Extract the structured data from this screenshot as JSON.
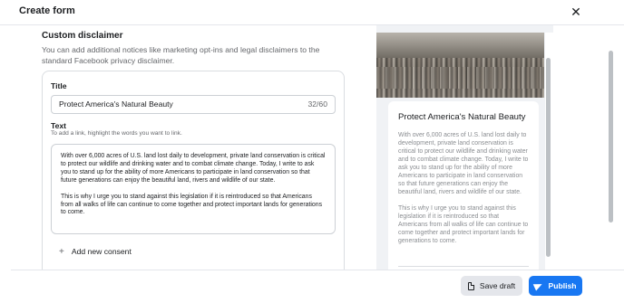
{
  "header": {
    "title": "Create form",
    "close_icon": "close-icon"
  },
  "section": {
    "title": "Custom disclaimer",
    "description": "You can add additional notices like marketing opt-ins and legal disclaimers to the standard Facebook privacy disclaimer."
  },
  "form": {
    "title_label": "Title",
    "title_value": "Protect America's Natural Beauty",
    "title_count": "32/60",
    "text_label": "Text",
    "text_hint": "To add a link, highlight the words you want to link.",
    "text_paragraph_1": "With over 6,000 acres of U.S. land lost daily to development, private land conservation is critical to protect our wildlife and drinking water and to combat climate change. Today, I write to ask you to stand up for the ability of more Americans to participate in land conservation so that future generations can enjoy the beautiful land, rivers and wildlife of our state.",
    "text_paragraph_2": "This is why I urge you to stand against this legislation if it is reintroduced so that Americans from all walks of life can continue to come together and protect important lands for generations to come.",
    "add_consent_label": "Add new consent"
  },
  "preview": {
    "title": "Protect America's Natural Beauty",
    "paragraph_1": "With over 6,000 acres of U.S. land lost daily to development, private land conservation is critical to protect our wildlife and drinking water and to combat climate change. Today, I write to ask you to stand up for the ability of more Americans to participate in land conservation so that future generations can enjoy the beautiful land, rivers and wildlife of our state.",
    "paragraph_2": "This is why I urge you to stand against this legislation if it is reintroduced so that Americans from all walks of life can continue to come together and protect important lands for generations to come."
  },
  "footer": {
    "save_draft_label": "Save draft",
    "publish_label": "Publish"
  },
  "colors": {
    "accent": "#1877f2",
    "secondary_button": "#e4e6eb",
    "preview_bg": "#f0f2f5"
  }
}
